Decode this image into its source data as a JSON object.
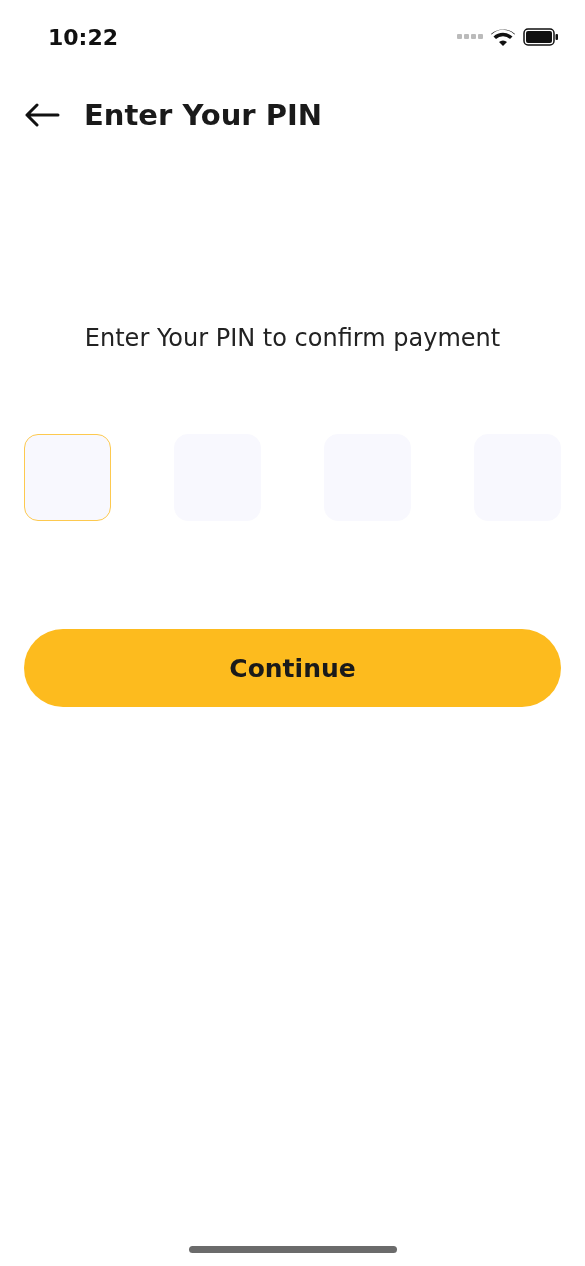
{
  "status_bar": {
    "time": "10:22"
  },
  "header": {
    "title": "Enter Your PIN"
  },
  "prompt": "Enter Your PIN to confirm payment",
  "pin_boxes": [
    {
      "selected": true
    },
    {
      "selected": false
    },
    {
      "selected": false
    },
    {
      "selected": false
    }
  ],
  "button": {
    "label": "Continue"
  }
}
